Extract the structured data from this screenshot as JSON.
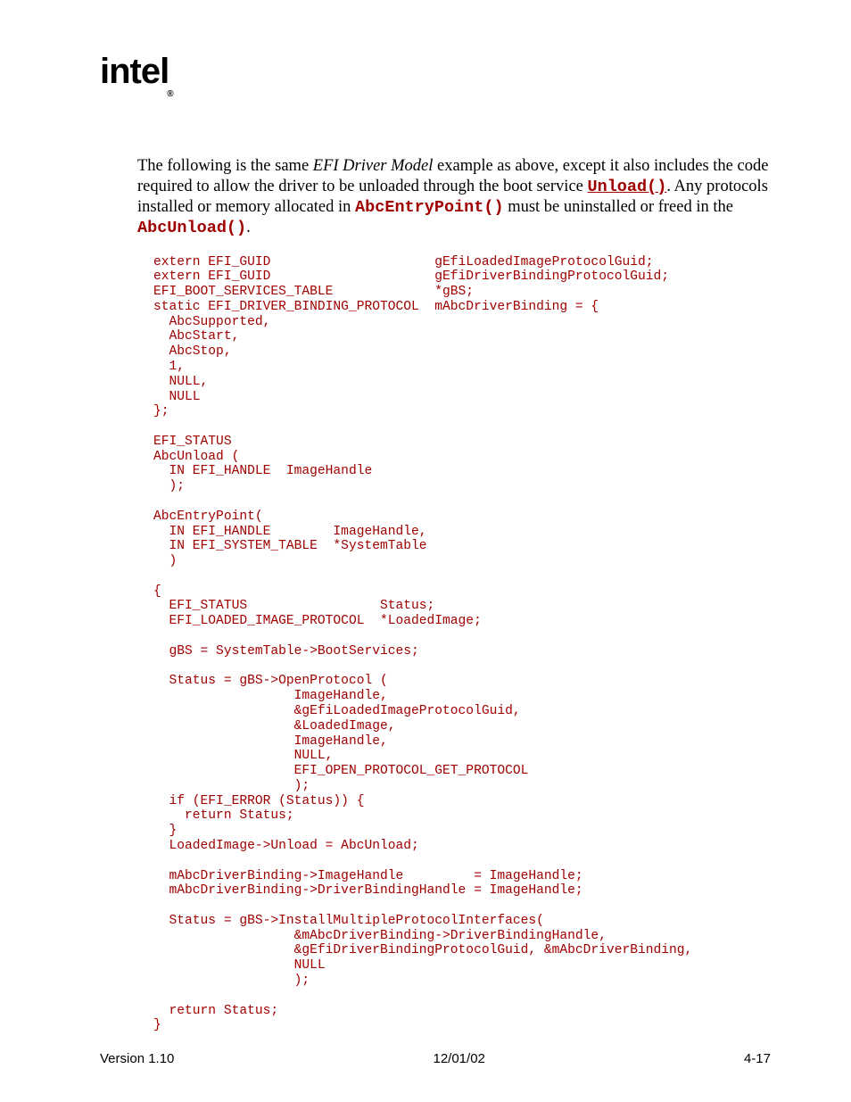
{
  "logo": {
    "text": "intel",
    "reg": "®"
  },
  "paragraph": {
    "t1": "The following is the same ",
    "italic": "EFI Driver Model",
    "t2": " example as above, except it also includes the code required to allow the driver to be unloaded through the boot service ",
    "link": "Unload()",
    "t3": ".  Any protocols installed or memory allocated in ",
    "code1": "AbcEntryPoint()",
    "t4": " must be uninstalled or freed in the ",
    "code2": "AbcUnload()",
    "t5": "."
  },
  "code": "extern EFI_GUID                     gEfiLoadedImageProtocolGuid;\nextern EFI_GUID                     gEfiDriverBindingProtocolGuid;\nEFI_BOOT_SERVICES_TABLE             *gBS;\nstatic EFI_DRIVER_BINDING_PROTOCOL  mAbcDriverBinding = {\n  AbcSupported,\n  AbcStart,\n  AbcStop,\n  1,\n  NULL,\n  NULL\n};\n\nEFI_STATUS\nAbcUnload (\n  IN EFI_HANDLE  ImageHandle\n  );\n\nAbcEntryPoint(\n  IN EFI_HANDLE        ImageHandle,\n  IN EFI_SYSTEM_TABLE  *SystemTable\n  )\n\n{\n  EFI_STATUS                 Status;\n  EFI_LOADED_IMAGE_PROTOCOL  *LoadedImage;\n\n  gBS = SystemTable->BootServices;\n\n  Status = gBS->OpenProtocol (\n                  ImageHandle,\n                  &gEfiLoadedImageProtocolGuid,\n                  &LoadedImage,\n                  ImageHandle,\n                  NULL,\n                  EFI_OPEN_PROTOCOL_GET_PROTOCOL\n                  );\n  if (EFI_ERROR (Status)) {\n    return Status;\n  }\n  LoadedImage->Unload = AbcUnload;\n\n  mAbcDriverBinding->ImageHandle         = ImageHandle;\n  mAbcDriverBinding->DriverBindingHandle = ImageHandle;\n\n  Status = gBS->InstallMultipleProtocolInterfaces(\n                  &mAbcDriverBinding->DriverBindingHandle,\n                  &gEfiDriverBindingProtocolGuid, &mAbcDriverBinding,\n                  NULL\n                  );\n\n  return Status;\n}",
  "footer": {
    "left": "Version 1.10",
    "center": "12/01/02",
    "right": "4-17"
  }
}
